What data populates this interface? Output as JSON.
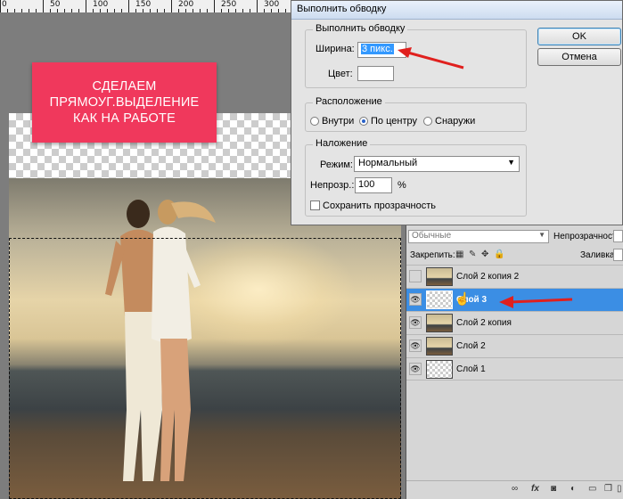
{
  "ruler": {
    "labels": [
      "0",
      "50",
      "100",
      "150",
      "200",
      "250",
      "300"
    ]
  },
  "banner": {
    "lines": [
      "СДЕЛАЕМ",
      "ПРЯМОУГ.ВЫДЕЛЕНИЕ",
      "КАК НА РАБОТЕ"
    ]
  },
  "dialog": {
    "title": "Выполнить обводку",
    "stroke_group": "Выполнить обводку",
    "width_label": "Ширина:",
    "width_value": "3 пикс.",
    "color_label": "Цвет:",
    "location_group": "Расположение",
    "location_options": [
      "Внутри",
      "По центру",
      "Снаружи"
    ],
    "location_selected": "По центру",
    "blending_group": "Наложение",
    "mode_label": "Режим:",
    "mode_value": "Нормальный",
    "opacity_label": "Непрозр.:",
    "opacity_value": "100",
    "opacity_unit": "%",
    "preserve_label": "Сохранить прозрачность",
    "ok_label": "OK",
    "cancel_label": "Отмена"
  },
  "layers_panel": {
    "blend_mode": "Обычные",
    "opacity_label": "Непрозрачность:",
    "lock_label": "Закрепить:",
    "fill_label": "Заливка:",
    "layers": [
      {
        "name": "Слой 2 копия 2",
        "visible": false,
        "thumb": "photo",
        "selected": false
      },
      {
        "name": "Слой 3",
        "visible": true,
        "thumb": "transparent",
        "selected": true
      },
      {
        "name": "Слой 2 копия",
        "visible": true,
        "thumb": "photo",
        "selected": false
      },
      {
        "name": "Слой 2",
        "visible": true,
        "thumb": "photo",
        "selected": false
      },
      {
        "name": "Слой 1",
        "visible": true,
        "thumb": "transparent",
        "selected": false
      }
    ],
    "footer_icons": [
      "link-icon",
      "fx-icon",
      "mask-icon",
      "adjustment-icon",
      "folder-icon",
      "new-layer-icon",
      "trash-icon"
    ]
  },
  "colors": {
    "banner": "#f0385c",
    "selected_layer": "#3b8ee4",
    "arrow": "#e0201e"
  }
}
